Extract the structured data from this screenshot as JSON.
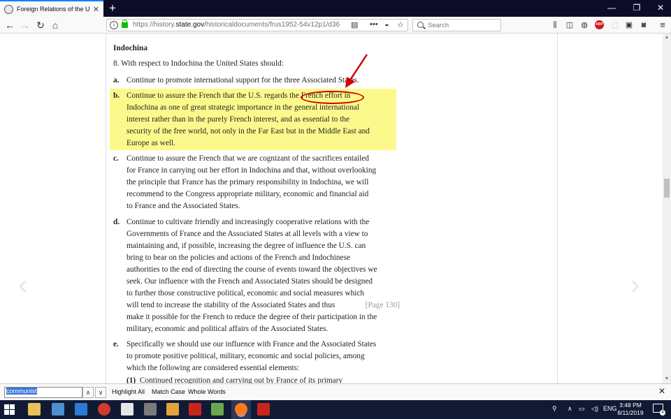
{
  "browser": {
    "tab_title": "Foreign Relations of the United",
    "tab_close": "✕",
    "new_tab": "+",
    "window_controls": {
      "minimize": "—",
      "maximize": "❐",
      "close": "✕"
    },
    "url_prefix": "https://history.",
    "url_domain": "state.gov",
    "url_path": "/historicaldocuments/frus1952-54v12p1/d36",
    "search_placeholder": "Search"
  },
  "document": {
    "heading": "Indochina",
    "intro": "8. With respect to Indochina the United States should:",
    "items": [
      {
        "label": "a.",
        "lines": [
          "Continue to promote international support for the three Associated States."
        ]
      },
      {
        "label": "b.",
        "lines": [
          "Continue to assure the French that the U.S. regards the French effort in",
          "Indochina as one of great strategic importance in the general international",
          "interest rather than in the purely French interest, and as essential to the",
          "security of the free world, not only in the Far East but in the Middle East and",
          "Europe as well."
        ]
      },
      {
        "label": "c.",
        "lines": [
          "Continue to assure the French that we are cognizant of the sacrifices entailed",
          "for France in carrying out her effort in Indochina and that, without overlooking",
          "the principle that France has the primary responsibility in Indochina, we will",
          "recommend to the Congress appropriate military, economic and financial aid",
          "to France and the Associated States."
        ]
      },
      {
        "label": "d.",
        "lines": [
          "Continue to cultivate friendly and increasingly cooperative relations with the",
          "Governments of France and the Associated States at all levels with a view to",
          "maintaining and, if possible, increasing the degree of influence the U.S. can",
          "bring to bear on the policies and actions of the French and Indochinese",
          "authorities to the end of directing the course of events toward the objectives we",
          "seek. Our influence with the French and Associated States should be designed",
          "to further those constructive political, economic and social measures which",
          "will tend to increase the stability of the Associated States and thus",
          "make it possible for the French to reduce the degree of their participation in the",
          "military, economic and political affairs of the Associated States."
        ],
        "page_ref": "[Page 130]"
      },
      {
        "label": "e.",
        "lines": [
          "Specifically we should use our influence with France and the Associated States",
          "to promote positive political, military, economic and social policies, among",
          "which the following are considered essential elements:"
        ]
      }
    ],
    "subitem": {
      "label": "(1)",
      "text": "Continued recognition and carrying out by France of its primary"
    }
  },
  "findbar": {
    "query": "communist",
    "highlight_all": "Highlight All",
    "match_case": "Match Case",
    "whole_words": "Whole Words",
    "close": "✕"
  },
  "taskbar": {
    "language": "ENG",
    "time": "3:48 PM",
    "date": "8/11/2019",
    "notification_count": "4"
  },
  "colors": {
    "highlight": "#fcf98c",
    "annotation_red": "#d00000",
    "taskbar_bg": "#111a35",
    "tabstrip_bg": "#0c0c28"
  }
}
